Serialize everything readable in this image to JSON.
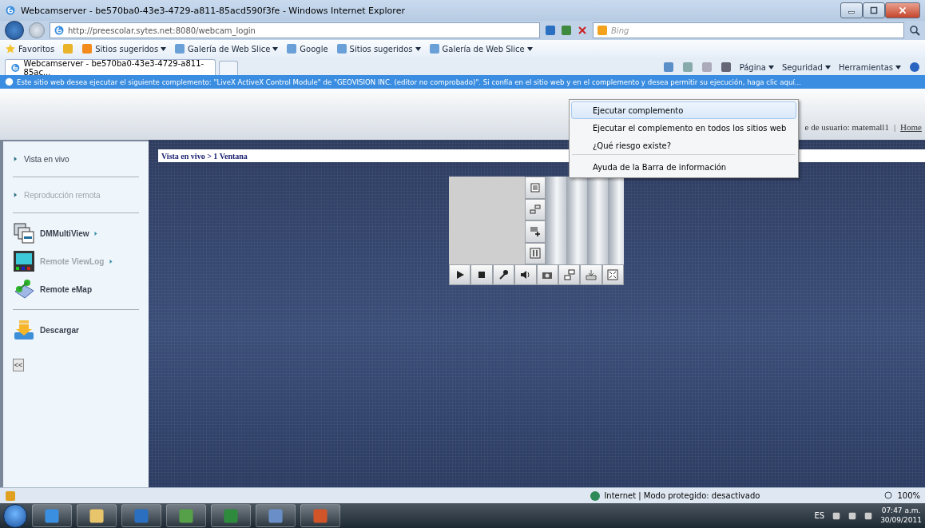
{
  "window": {
    "title": "Webcamserver - be570ba0-43e3-4729-a811-85acd590f3fe - Windows Internet Explorer"
  },
  "address_bar": {
    "url": "http://preescolar.sytes.net:8080/webcam_login",
    "search_placeholder": "Bing"
  },
  "favorites_bar": {
    "label": "Favoritos",
    "items": [
      {
        "label": "Sitios sugeridos",
        "dropdown": true
      },
      {
        "label": "Galería de Web Slice",
        "dropdown": true
      },
      {
        "label": "Google",
        "dropdown": false
      },
      {
        "label": "Sitios sugeridos",
        "dropdown": true
      },
      {
        "label": "Galería de Web Slice",
        "dropdown": true
      }
    ]
  },
  "tabs": [
    {
      "label": "Webcamserver - be570ba0-43e3-4729-a811-85ac...",
      "selected": true
    }
  ],
  "command_bar": [
    "Página",
    "Seguridad",
    "Herramientas"
  ],
  "info_bar": {
    "text": "Este sitio web desea ejecutar el siguiente complemento: \"LiveX ActiveX Control Module\" de \"GEOVISION INC. (editor no comprobado)\". Si confía en el sitio web y en el complemento y desea permitir su ejecución, haga clic aquí..."
  },
  "info_menu": {
    "items": [
      {
        "label": "Ejecutar complemento",
        "selected": true,
        "separator_before": false
      },
      {
        "label": "Ejecutar el complemento en todos los sitios web",
        "selected": false,
        "separator_before": false
      },
      {
        "label": "¿Qué riesgo existe?",
        "selected": false,
        "separator_before": false
      },
      {
        "label": "Ayuda de la Barra de información",
        "selected": false,
        "separator_before": true
      }
    ]
  },
  "header": {
    "user": "e de usuario: matemall1",
    "separator": "|",
    "link": "Home"
  },
  "sidebar": {
    "items": [
      {
        "label": "Vista en vivo",
        "kind": "arrow",
        "disabled": false,
        "submenu": false,
        "divider_after": true
      },
      {
        "label": "Reproducción remota",
        "kind": "arrow",
        "disabled": true,
        "submenu": false,
        "divider_after": true
      },
      {
        "label": "DMMultiView",
        "kind": "app",
        "disabled": false,
        "submenu": true,
        "divider_after": false
      },
      {
        "label": "Remote ViewLog",
        "kind": "app",
        "disabled": true,
        "submenu": true,
        "divider_after": false
      },
      {
        "label": "Remote eMap",
        "kind": "app",
        "disabled": false,
        "submenu": false,
        "divider_after": true
      },
      {
        "label": "Descargar",
        "kind": "app",
        "disabled": false,
        "submenu": false,
        "divider_after": false
      }
    ],
    "collapse_button": "<<"
  },
  "breadcrumb": "Vista en vivo > 1 Ventana",
  "status_bar": {
    "zone": "Internet | Modo protegido: desactivado",
    "zoom": "100%"
  },
  "taskbar": {
    "language": "ES",
    "time": "07:47 a.m.",
    "date": "30/09/2011"
  }
}
